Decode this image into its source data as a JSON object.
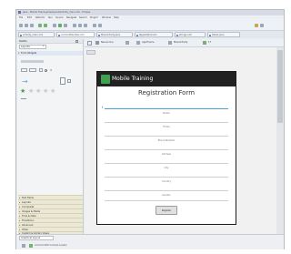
{
  "window": {
    "title": "Java - Mobile Training/res/layout/activity_main.xml - Eclipse",
    "menu": [
      "File",
      "Edit",
      "Refactor",
      "Run",
      "Source",
      "Navigate",
      "Search",
      "Project",
      "Window",
      "Help"
    ]
  },
  "tabs": [
    {
      "label": "activity_main.xml",
      "active": false
    },
    {
      "label": "AndroidManifest.xml",
      "active": true
    },
    {
      "label": "MainActivity.java",
      "active": false
    },
    {
      "label": "RegistrationAct..",
      "active": false
    },
    {
      "label": "strings.xml",
      "active": false
    },
    {
      "label": "Detail.java",
      "active": false
    }
  ],
  "palette": {
    "title": "Palette",
    "filter": "Layouts",
    "form_widgets_label": "Form Widgets",
    "categories": [
      "Text Fields",
      "Layouts",
      "Composite",
      "Images & Media",
      "Time & Date",
      "Transitions",
      "Advanced",
      "Other",
      "Custom & Library Views"
    ]
  },
  "editor": {
    "device": "Nexus One",
    "theme": "AppTheme",
    "activity": "MainActivity",
    "api_level": "17"
  },
  "device_screen": {
    "app_title": "Mobile Training",
    "form_title": "Registration Form",
    "fields": [
      "Name",
      "Email",
      "Phone Number",
      "Address",
      "City",
      "Country",
      "Gender"
    ],
    "button_label": "Register"
  },
  "status": {
    "tabs": "Graphical Layout",
    "message": "Android SDK Content Loader"
  }
}
